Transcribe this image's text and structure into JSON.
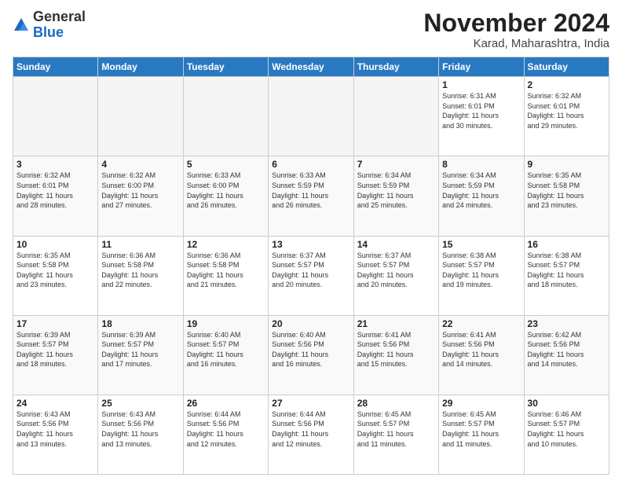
{
  "logo": {
    "general": "General",
    "blue": "Blue"
  },
  "header": {
    "month": "November 2024",
    "location": "Karad, Maharashtra, India"
  },
  "weekdays": [
    "Sunday",
    "Monday",
    "Tuesday",
    "Wednesday",
    "Thursday",
    "Friday",
    "Saturday"
  ],
  "weeks": [
    [
      {
        "day": "",
        "info": ""
      },
      {
        "day": "",
        "info": ""
      },
      {
        "day": "",
        "info": ""
      },
      {
        "day": "",
        "info": ""
      },
      {
        "day": "",
        "info": ""
      },
      {
        "day": "1",
        "info": "Sunrise: 6:31 AM\nSunset: 6:01 PM\nDaylight: 11 hours\nand 30 minutes."
      },
      {
        "day": "2",
        "info": "Sunrise: 6:32 AM\nSunset: 6:01 PM\nDaylight: 11 hours\nand 29 minutes."
      }
    ],
    [
      {
        "day": "3",
        "info": "Sunrise: 6:32 AM\nSunset: 6:01 PM\nDaylight: 11 hours\nand 28 minutes."
      },
      {
        "day": "4",
        "info": "Sunrise: 6:32 AM\nSunset: 6:00 PM\nDaylight: 11 hours\nand 27 minutes."
      },
      {
        "day": "5",
        "info": "Sunrise: 6:33 AM\nSunset: 6:00 PM\nDaylight: 11 hours\nand 26 minutes."
      },
      {
        "day": "6",
        "info": "Sunrise: 6:33 AM\nSunset: 5:59 PM\nDaylight: 11 hours\nand 26 minutes."
      },
      {
        "day": "7",
        "info": "Sunrise: 6:34 AM\nSunset: 5:59 PM\nDaylight: 11 hours\nand 25 minutes."
      },
      {
        "day": "8",
        "info": "Sunrise: 6:34 AM\nSunset: 5:59 PM\nDaylight: 11 hours\nand 24 minutes."
      },
      {
        "day": "9",
        "info": "Sunrise: 6:35 AM\nSunset: 5:58 PM\nDaylight: 11 hours\nand 23 minutes."
      }
    ],
    [
      {
        "day": "10",
        "info": "Sunrise: 6:35 AM\nSunset: 5:58 PM\nDaylight: 11 hours\nand 23 minutes."
      },
      {
        "day": "11",
        "info": "Sunrise: 6:36 AM\nSunset: 5:58 PM\nDaylight: 11 hours\nand 22 minutes."
      },
      {
        "day": "12",
        "info": "Sunrise: 6:36 AM\nSunset: 5:58 PM\nDaylight: 11 hours\nand 21 minutes."
      },
      {
        "day": "13",
        "info": "Sunrise: 6:37 AM\nSunset: 5:57 PM\nDaylight: 11 hours\nand 20 minutes."
      },
      {
        "day": "14",
        "info": "Sunrise: 6:37 AM\nSunset: 5:57 PM\nDaylight: 11 hours\nand 20 minutes."
      },
      {
        "day": "15",
        "info": "Sunrise: 6:38 AM\nSunset: 5:57 PM\nDaylight: 11 hours\nand 19 minutes."
      },
      {
        "day": "16",
        "info": "Sunrise: 6:38 AM\nSunset: 5:57 PM\nDaylight: 11 hours\nand 18 minutes."
      }
    ],
    [
      {
        "day": "17",
        "info": "Sunrise: 6:39 AM\nSunset: 5:57 PM\nDaylight: 11 hours\nand 18 minutes."
      },
      {
        "day": "18",
        "info": "Sunrise: 6:39 AM\nSunset: 5:57 PM\nDaylight: 11 hours\nand 17 minutes."
      },
      {
        "day": "19",
        "info": "Sunrise: 6:40 AM\nSunset: 5:57 PM\nDaylight: 11 hours\nand 16 minutes."
      },
      {
        "day": "20",
        "info": "Sunrise: 6:40 AM\nSunset: 5:56 PM\nDaylight: 11 hours\nand 16 minutes."
      },
      {
        "day": "21",
        "info": "Sunrise: 6:41 AM\nSunset: 5:56 PM\nDaylight: 11 hours\nand 15 minutes."
      },
      {
        "day": "22",
        "info": "Sunrise: 6:41 AM\nSunset: 5:56 PM\nDaylight: 11 hours\nand 14 minutes."
      },
      {
        "day": "23",
        "info": "Sunrise: 6:42 AM\nSunset: 5:56 PM\nDaylight: 11 hours\nand 14 minutes."
      }
    ],
    [
      {
        "day": "24",
        "info": "Sunrise: 6:43 AM\nSunset: 5:56 PM\nDaylight: 11 hours\nand 13 minutes."
      },
      {
        "day": "25",
        "info": "Sunrise: 6:43 AM\nSunset: 5:56 PM\nDaylight: 11 hours\nand 13 minutes."
      },
      {
        "day": "26",
        "info": "Sunrise: 6:44 AM\nSunset: 5:56 PM\nDaylight: 11 hours\nand 12 minutes."
      },
      {
        "day": "27",
        "info": "Sunrise: 6:44 AM\nSunset: 5:56 PM\nDaylight: 11 hours\nand 12 minutes."
      },
      {
        "day": "28",
        "info": "Sunrise: 6:45 AM\nSunset: 5:57 PM\nDaylight: 11 hours\nand 11 minutes."
      },
      {
        "day": "29",
        "info": "Sunrise: 6:45 AM\nSunset: 5:57 PM\nDaylight: 11 hours\nand 11 minutes."
      },
      {
        "day": "30",
        "info": "Sunrise: 6:46 AM\nSunset: 5:57 PM\nDaylight: 11 hours\nand 10 minutes."
      }
    ]
  ]
}
